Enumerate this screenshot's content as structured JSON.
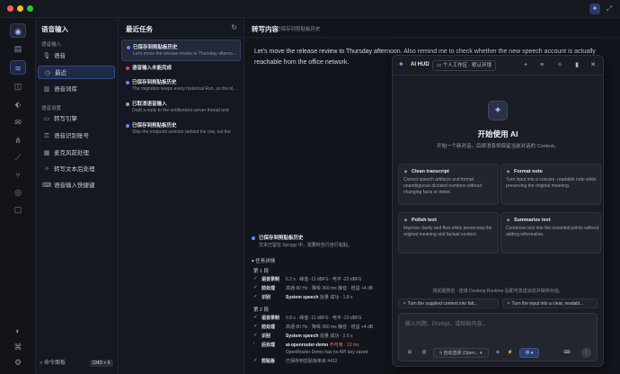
{
  "colors": {
    "accent": "#5b8cff",
    "success": "#22c55e",
    "error": "#ef4444",
    "warning": "#f59e0b"
  },
  "nav": {
    "title": "语音输入",
    "section1": "语音输入",
    "items": [
      {
        "label": "语音",
        "icon": "mic-icon"
      },
      {
        "label": "最近",
        "icon": "clock-icon"
      },
      {
        "label": "语音词库",
        "icon": "book-icon"
      }
    ],
    "section2": "语音设置",
    "settings": [
      {
        "label": "转写引擎",
        "icon": "chat-icon"
      },
      {
        "label": "语音识别账号",
        "icon": "key-icon"
      },
      {
        "label": "麦克风前处理",
        "icon": "filter-icon"
      },
      {
        "label": "转写文本后处理",
        "icon": "sparkle-icon"
      },
      {
        "label": "语音输入快捷键",
        "icon": "keyboard-icon"
      }
    ],
    "command_palette": "命令面板",
    "command_shortcut": "CMD + K"
  },
  "tasks": {
    "title": "最近任务",
    "items": [
      {
        "title": "已保存到剪贴板历史",
        "preview": "Let's move the release review to Thursday afternoon. Also remind me",
        "status": "blue"
      },
      {
        "title": "语音输入未能完成",
        "preview": "",
        "status": "red"
      },
      {
        "title": "已保存到剪贴板历史",
        "preview": "The migration keeps every historical Run, so the old entries",
        "status": "blue"
      },
      {
        "title": "已取消语音输入",
        "preview": "Draft a reply to the entitlement server thread and",
        "status": "gray"
      },
      {
        "title": "已保存到剪贴板历史",
        "preview": "Ship the endpoint selector behind the row, not the",
        "status": "blue"
      }
    ]
  },
  "detail": {
    "title": "转写内容",
    "subtitle": "已保存到剪贴板历史",
    "text": "Let's move the release review to Thursday afternoon. Also remind me to check whether the new speech account is actually reachable from the office network.",
    "saved_title": "已保存到剪贴板历史",
    "saved_desc": "文本已留在 Sycygy 中，需要时自行自行粘贴。",
    "task_detail_label": "任务详情",
    "round1": "第 1 段",
    "round1_rows": [
      {
        "label": "语音录制",
        "value": "6.2 s · 峰值 -11 dBFS · 电平 -23 dBFS"
      },
      {
        "label": "前处理",
        "value": "高通 80 Hz · 降噪 360 ms 静音 · 增益 +4 dB"
      },
      {
        "label": "识别",
        "engine": "System speech",
        "value": "批量 成功 · 1.8 s"
      }
    ],
    "round2": "第 2 段",
    "round2_rows": [
      {
        "label": "语音录制",
        "value": "9.8 s · 峰值 -11 dBFS · 电平 -23 dBFS"
      },
      {
        "label": "前处理",
        "value": "高通 80 Hz · 降噪 360 ms 静音 · 增益 +4 dB"
      },
      {
        "label": "识别",
        "engine": "System speech",
        "value": "批量 成功 · 2.6 s"
      },
      {
        "label": "后处理",
        "engine": "ai-openrouter-demo",
        "error": "不可用 · 12 ms",
        "note": "OpenRouter Demo has no API key saved"
      },
      {
        "label": "剪贴板",
        "value": "已保存到剪贴板条目 #412"
      }
    ]
  },
  "hud": {
    "name": "AI HUD",
    "workspace": "个人工作区 · 默认环境",
    "hero_title": "开始使用 AI",
    "hero_desc": "开始一个新对话。后续消息将保留当前对话的 Context。",
    "cards": [
      {
        "title": "Clean transcript",
        "desc": "Correct speech artifacts and format unambiguous dictated numbers without changing facts or intent."
      },
      {
        "title": "Format note",
        "desc": "Turn input into a concise, readable note while preserving the original meaning."
      },
      {
        "title": "Polish text",
        "desc": "Improve clarity and flow while preserving the original meaning and factual content."
      },
      {
        "title": "Summarize text",
        "desc": "Condense text into the essential points without adding information."
      }
    ],
    "status": "测试题预览 · 连接 Desktop Runtime 后即可发送消息并保存对话。",
    "suggestions": [
      "Turn the supplied content into fait...",
      "Turn the input into a clear, readabl..."
    ],
    "input_placeholder": "输入问题、Prompt，或粘贴内容...",
    "model": "自动选择 (Open...",
    "language": "中"
  }
}
